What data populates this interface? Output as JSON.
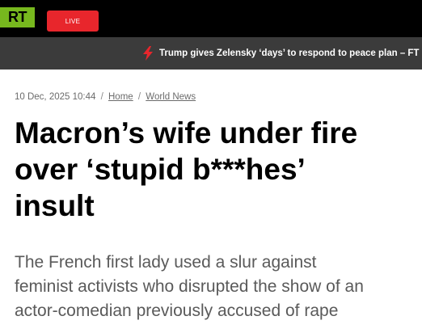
{
  "header": {
    "logo_text": "RT",
    "logo_color": "#77b81e",
    "live_label": "LIVE",
    "live_color": "#e8262c"
  },
  "ticker": {
    "icon": "lightning-bolt-icon",
    "text": "Trump gives Zelensky ‘days’ to respond to peace plan – FT | I"
  },
  "meta": {
    "date": "10 Dec, 2025 10:44",
    "breadcrumb": [
      "Home",
      "World News"
    ]
  },
  "article": {
    "headline_lines": [
      "Macron’s wife under fire",
      "over ‘stupid b***hes’",
      "insult"
    ],
    "summary_lines": [
      "The French first lady used a slur against",
      "feminist activists who disrupted the show of an",
      "actor-comedian previously accused of rape"
    ]
  }
}
